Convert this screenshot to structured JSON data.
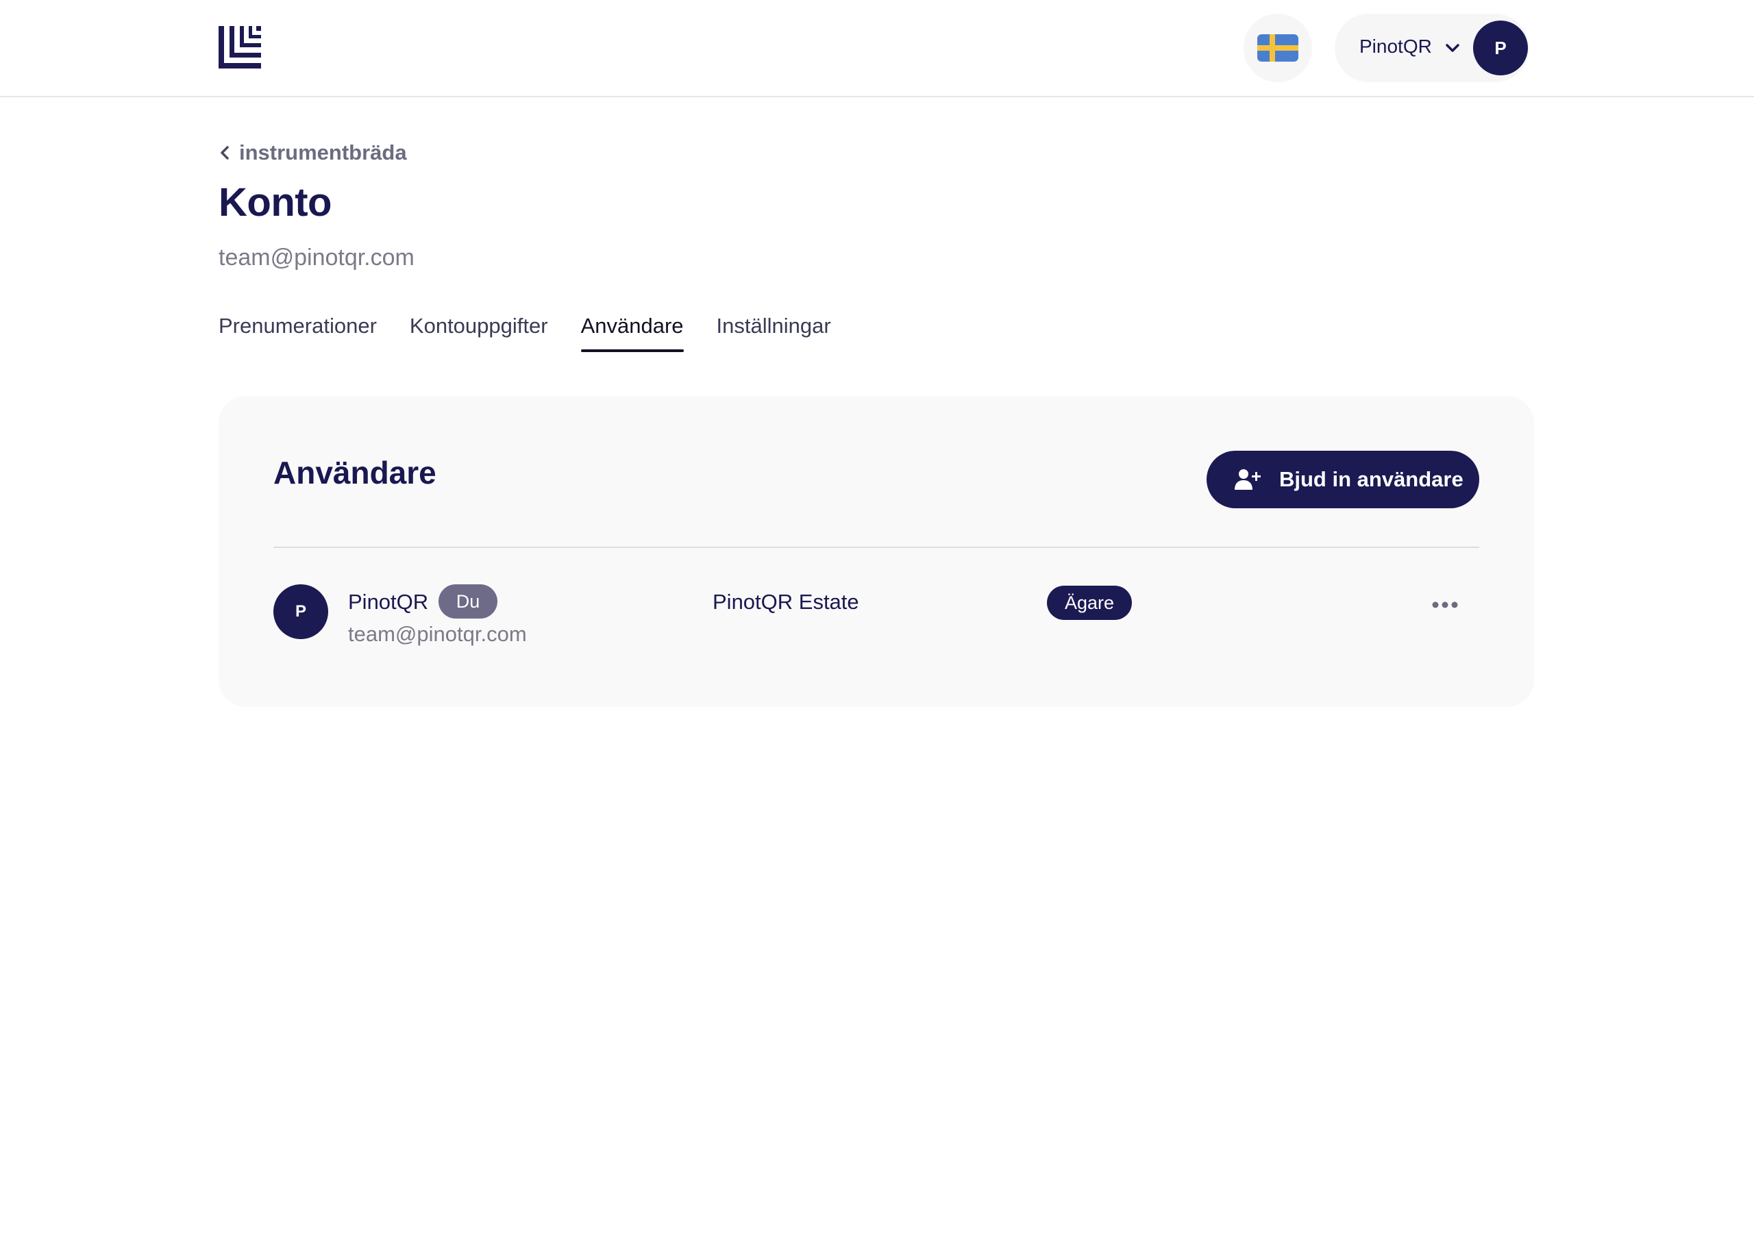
{
  "header": {
    "logo_icon": "brand-logo-icon",
    "language_flag": "sweden-flag-icon",
    "user_menu": {
      "name": "PinotQR",
      "chevron_icon": "chevron-down-icon",
      "avatar_initial": "P"
    }
  },
  "breadcrumb": {
    "icon": "chevron-left-icon",
    "label": "instrumentbräda"
  },
  "page": {
    "title": "Konto",
    "subtitle": "team@pinotqr.com"
  },
  "tabs": [
    {
      "label": "Prenumerationer",
      "active": false
    },
    {
      "label": "Kontouppgifter",
      "active": false
    },
    {
      "label": "Användare",
      "active": true
    },
    {
      "label": "Inställningar",
      "active": false
    }
  ],
  "users_card": {
    "title": "Användare",
    "invite_button": {
      "icon": "user-plus-icon",
      "label": "Bjud in användare"
    },
    "rows": [
      {
        "avatar_initial": "P",
        "name": "PinotQR",
        "you_badge": "Du",
        "email": "team@pinotqr.com",
        "organization": "PinotQR Estate",
        "role": "Ägare",
        "more_icon": "more-horizontal-icon"
      }
    ]
  },
  "colors": {
    "primary": "#1c1a52",
    "muted_text": "#7a7a88",
    "card_bg": "#f9f9fa",
    "badge_muted": "#6d6b87",
    "flag_blue": "#4a7fd0",
    "flag_yellow": "#f5c33b"
  }
}
